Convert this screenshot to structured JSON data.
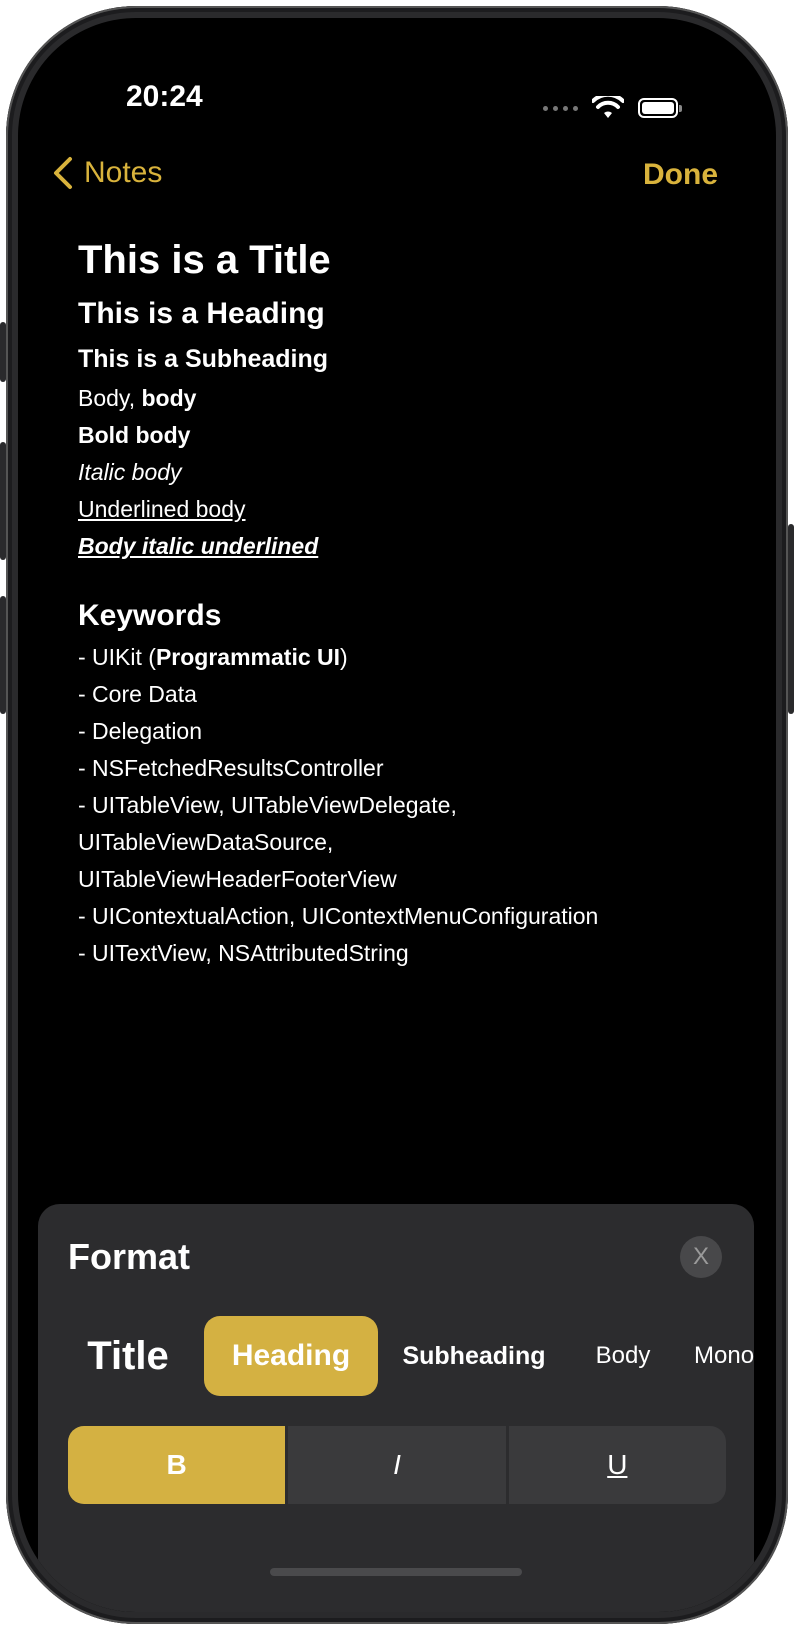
{
  "status_bar": {
    "time": "20:24"
  },
  "nav": {
    "back_label": "Notes",
    "done_label": "Done"
  },
  "note": {
    "title": "This is a Title",
    "heading": "This is a Heading",
    "subheading": "This is a Subheading",
    "body_plain": "Body,",
    "body_bold_part": "body",
    "bold_body": "Bold body",
    "italic_body": "Italic body",
    "underlined_body": "Underlined body",
    "italic_underlined": "Body italic underlined",
    "keywords_heading": "Keywords",
    "kw1_prefix": "- UIKit (",
    "kw1_bold": "Programmatic UI",
    "kw1_suffix": ")",
    "kw2": "- Core Data",
    "kw3": "- Delegation",
    "kw4": "- NSFetchedResultsController",
    "kw5a": "- UITableView, UITableViewDelegate,",
    "kw5b": "UITableViewDataSource,",
    "kw5c": "UITableViewHeaderFooterView",
    "kw6": "- UIContextualAction, UIContextMenuConfiguration",
    "kw7": "- UITextView, NSAttributedString"
  },
  "format_panel": {
    "title": "Format",
    "close_label": "X",
    "styles": [
      "Title",
      "Heading",
      "Subheading",
      "Body",
      "Mono"
    ],
    "selected_style": "Heading",
    "bold_label": "B",
    "italic_label": "I",
    "underline_label": "U",
    "bold_active": true
  },
  "colors": {
    "accent": "#d9b33c",
    "panel_bg": "#2c2c2e",
    "selected_bg": "#d4b142"
  }
}
